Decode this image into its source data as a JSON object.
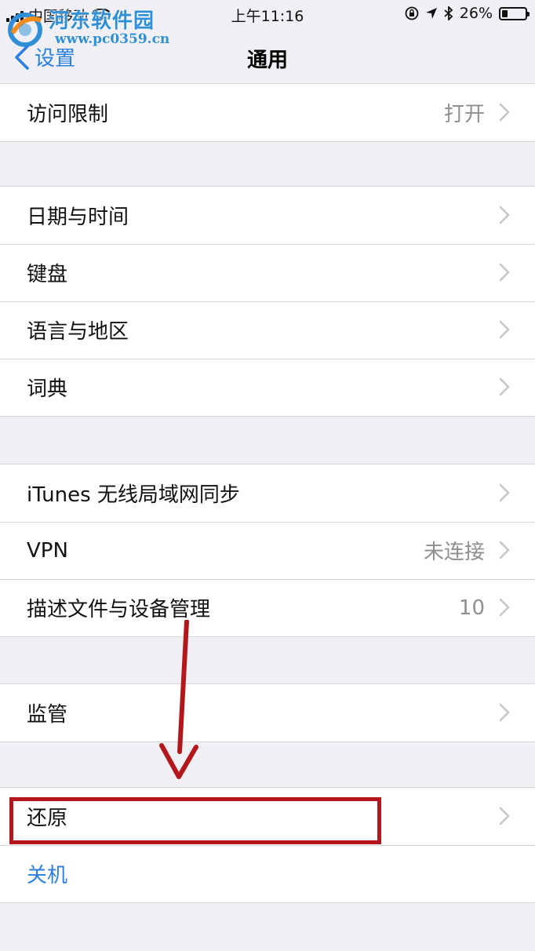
{
  "status_bar": {
    "carrier": "中国移动",
    "time": "上午11:16",
    "battery": "26%",
    "battery_level": 0.26
  },
  "watermark": {
    "title": "河东软件园",
    "url": "www.pc0359.cn"
  },
  "nav": {
    "back_label": "设置",
    "title": "通用"
  },
  "groups": [
    {
      "rows": [
        {
          "label": "访问限制",
          "value": "打开"
        }
      ]
    },
    {
      "rows": [
        {
          "label": "日期与时间",
          "value": ""
        },
        {
          "label": "键盘",
          "value": ""
        },
        {
          "label": "语言与地区",
          "value": ""
        },
        {
          "label": "词典",
          "value": ""
        }
      ]
    },
    {
      "rows": [
        {
          "label": "iTunes 无线局域网同步",
          "value": ""
        },
        {
          "label": "VPN",
          "value": "未连接"
        },
        {
          "label": "描述文件与设备管理",
          "value": "10"
        }
      ]
    },
    {
      "rows": [
        {
          "label": "监管",
          "value": ""
        }
      ]
    },
    {
      "rows": [
        {
          "label": "还原",
          "value": ""
        },
        {
          "label": "关机",
          "value": ""
        }
      ]
    }
  ],
  "colors": {
    "accent": "#2a7fe0",
    "annotation": "#b3171b",
    "background": "#efeff4"
  }
}
